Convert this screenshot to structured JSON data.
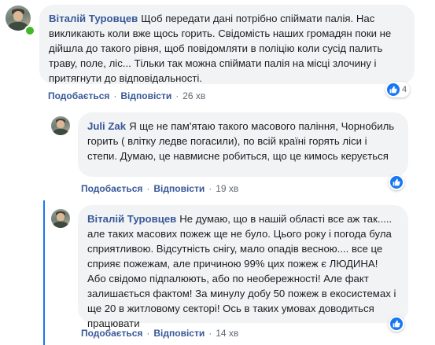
{
  "comments": [
    {
      "author": "Віталій Туровцев",
      "text": "Щоб передати дані потрібно спіймати палія. Нас викликають коли вже щось горить. Свідомість наших громадян поки не дійшла до такого рівня, щоб повідомляти в поліцію коли сусід палить траву, поле, ліс... Тільки так можна спіймати палія на місці злочину і притягнути до відповідальності.",
      "like_label": "Подобається",
      "reply_label": "Відповісти",
      "time": "26 хв",
      "reactions": "4",
      "online": true
    },
    {
      "author": "Juli Zak",
      "text": "Я ще не пам'ятаю такого масового паління, Чорнобиль горить ( влітку ледве погасили), по всій країні горять ліси і степи. Думаю, це навмисне робиться, що це кимось керується",
      "like_label": "Подобається",
      "reply_label": "Відповісти",
      "time": "19 хв"
    },
    {
      "author": "Віталій Туровцев",
      "text": "Не думаю, що в нашій області все аж так..... але таких масових пожеж ще не було. Цього року і погода була сприятливою. Відсутність снігу, мало опадів весною.... все це сприяє пожежам, але причиною 99% цих пожеж є ЛЮДИНА! Або свідомо підпалюють, або по необережності! Але факт залишається фактом! За минулу добу 50 пожеж в екосистемах і ще 20 в житловому секторі! Ось в таких умовах доводиться працювати",
      "like_label": "Подобається",
      "reply_label": "Відповісти",
      "time": "14 хв"
    }
  ],
  "colors": {
    "author": "#385898",
    "bubble": "#f2f3f5",
    "like": "#1877f2",
    "meta": "#606770",
    "online": "#42b72a"
  },
  "icons": {
    "like": "thumbs-up-icon"
  },
  "separator": "·"
}
